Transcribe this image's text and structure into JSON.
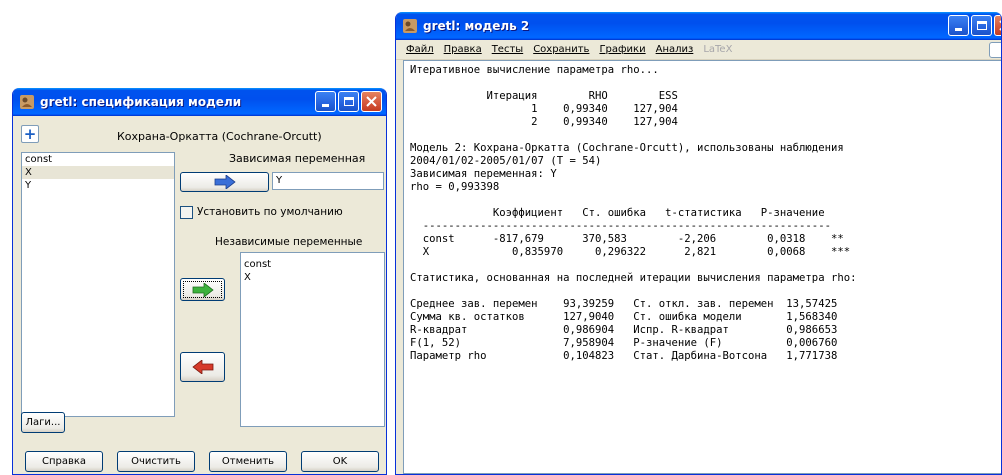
{
  "spec_dialog": {
    "title": "gretl: спецификация модели",
    "method_label": "Кохрана-Оркатта (Cochrane-Orcutt)",
    "variables": [
      "const",
      "X",
      "Y"
    ],
    "dependent_label": "Зависимая переменная",
    "dependent_value": "Y",
    "default_checkbox_label": "Установить по умолчанию",
    "independent_label": "Независимые переменные",
    "independent_vars": [
      "const",
      "X"
    ],
    "lags_button": "Лаги...",
    "help_button": "Справка",
    "clear_button": "Очистить",
    "cancel_button": "Отменить",
    "ok_button": "OK"
  },
  "model_window": {
    "title": "gretl: модель 2",
    "menu": [
      "Файл",
      "Правка",
      "Тесты",
      "Сохранить",
      "Графики",
      "Анализ",
      "LaTeX"
    ],
    "output_lines": [
      "Итеративное вычисление параметра rho...",
      "",
      "            Итерация        RHO        ESS",
      "                   1    0,99340    127,904",
      "                   2    0,99340    127,904",
      "",
      "Модель 2: Кохрана-Оркатта (Cochrane-Orcutt), использованы наблюдения",
      "2004/01/02-2005/01/07 (T = 54)",
      "Зависимая переменная: Y",
      "rho = 0,993398",
      "",
      "             Коэффициент   Ст. ошибка   t-статистика   P-значение",
      "  ----------------------------------------------------------------",
      "  const      -817,679      370,583        -2,206        0,0318    **",
      "  X             0,835970     0,296322      2,821        0,0068    ***",
      "",
      "Статистика, основанная на последней итерации вычисления параметра rho:",
      "",
      "Среднее зав. перемен    93,39259   Ст. откл. зав. перемен  13,57425",
      "Сумма кв. остатков      127,9040   Ст. ошибка модели       1,568340",
      "R-квадрат               0,986904   Испр. R-квадрат         0,986653",
      "F(1, 52)                7,958904   P-значение (F)          0,006760",
      "Параметр rho            0,104823   Стат. Дарбина-Вотсона   1,771738"
    ]
  },
  "icons": {
    "app": "gretl-app-icon",
    "arrow_right_blue": "arrow-right-icon",
    "arrow_right_green": "arrow-right-icon",
    "arrow_left_red": "arrow-left-icon"
  },
  "colors": {
    "titlebar": "#0053ee",
    "close_button": "#d4553a",
    "window_bg": "#ece9d8",
    "arrow_blue": "#3a6fd8",
    "arrow_green": "#3cb23c",
    "arrow_red": "#d63a2a"
  }
}
